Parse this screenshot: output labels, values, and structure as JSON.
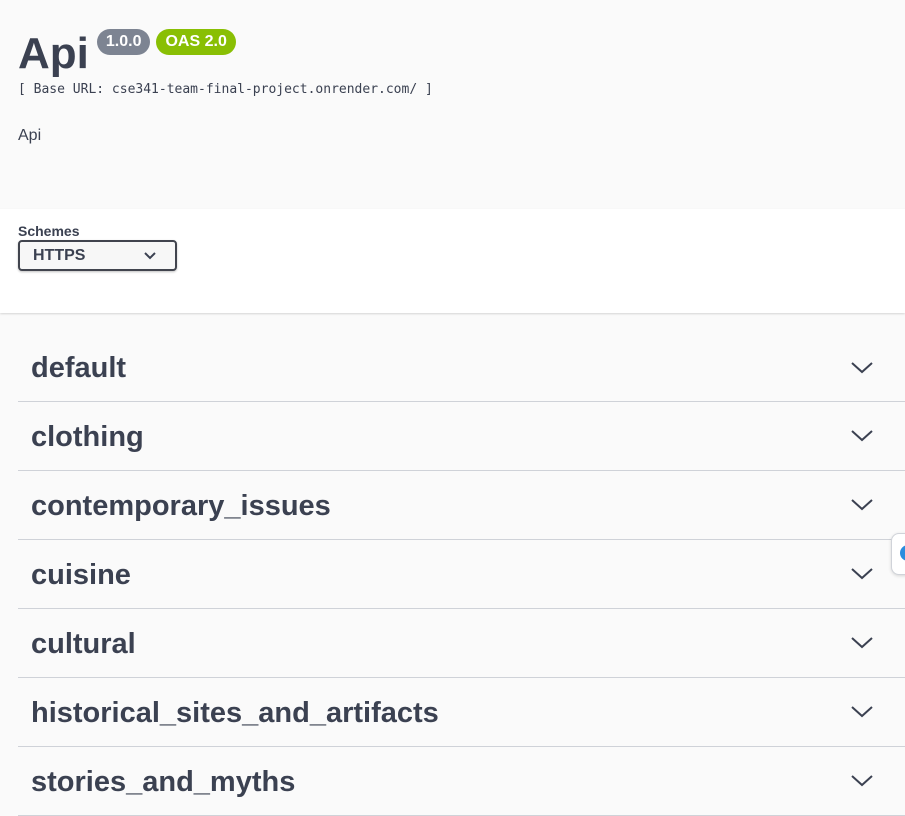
{
  "info": {
    "title": "Api",
    "version": "1.0.0",
    "oas_badge": "OAS 2.0",
    "base_url": "[ Base URL: cse341-team-final-project.onrender.com/ ]",
    "description": "Api"
  },
  "schemes": {
    "label": "Schemes",
    "selected": "HTTPS"
  },
  "tags": [
    {
      "name": "default"
    },
    {
      "name": "clothing"
    },
    {
      "name": "contemporary_issues"
    },
    {
      "name": "cuisine"
    },
    {
      "name": "cultural"
    },
    {
      "name": "historical_sites_and_artifacts"
    },
    {
      "name": "stories_and_myths"
    }
  ],
  "colors": {
    "text": "#3b4151",
    "version_badge": "#7d8492",
    "oas_badge": "#89bf04",
    "background": "#fafafa"
  },
  "icons": {
    "tag_expand": "chevron-down-icon",
    "schemes_dropdown": "chevron-down-icon",
    "floating_widget": "extension-icon"
  }
}
